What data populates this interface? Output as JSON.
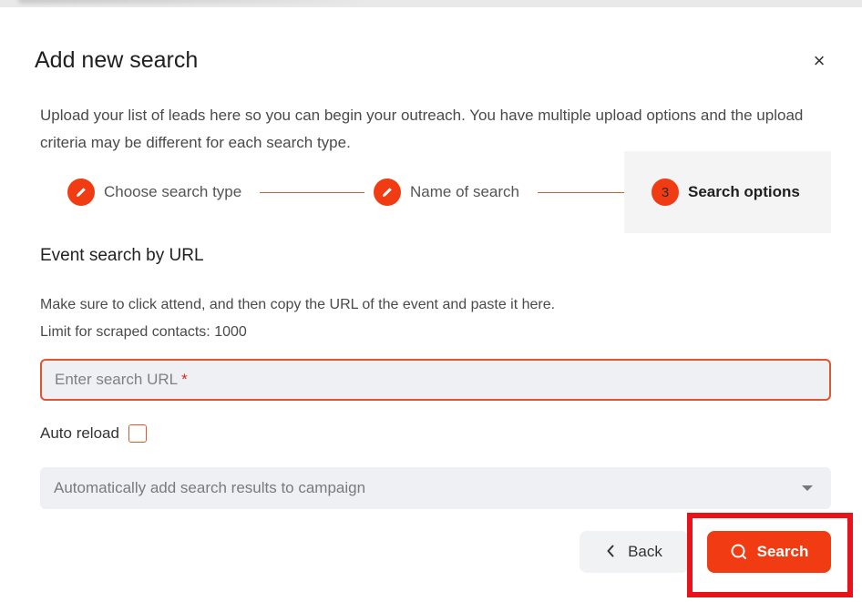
{
  "dialog": {
    "title": "Add new search",
    "close_glyph": "×",
    "description": "Upload your list of leads here so you can begin your outreach. You have multiple upload options and the upload criteria may be different for each search type."
  },
  "stepper": {
    "steps": [
      {
        "label": "Choose search type",
        "icon": "pencil-icon",
        "state": "done"
      },
      {
        "label": "Name of search",
        "icon": "pencil-icon",
        "state": "done"
      },
      {
        "label": "Search options",
        "number": "3",
        "state": "active"
      }
    ]
  },
  "form": {
    "section_title": "Event search by URL",
    "help_line1": "Make sure to click attend, and then copy the URL of the event and paste it here.",
    "help_line2": "Limit for scraped contacts: 1000",
    "url_placeholder": "Enter search URL",
    "required_mark": "*",
    "auto_reload_label": "Auto reload",
    "campaign_select_placeholder": "Automatically add search results to campaign"
  },
  "actions": {
    "back_label": "Back",
    "search_label": "Search"
  },
  "colors": {
    "accent": "#f13c13",
    "highlight": "#e8131a",
    "input_bg": "#eff0f3"
  }
}
